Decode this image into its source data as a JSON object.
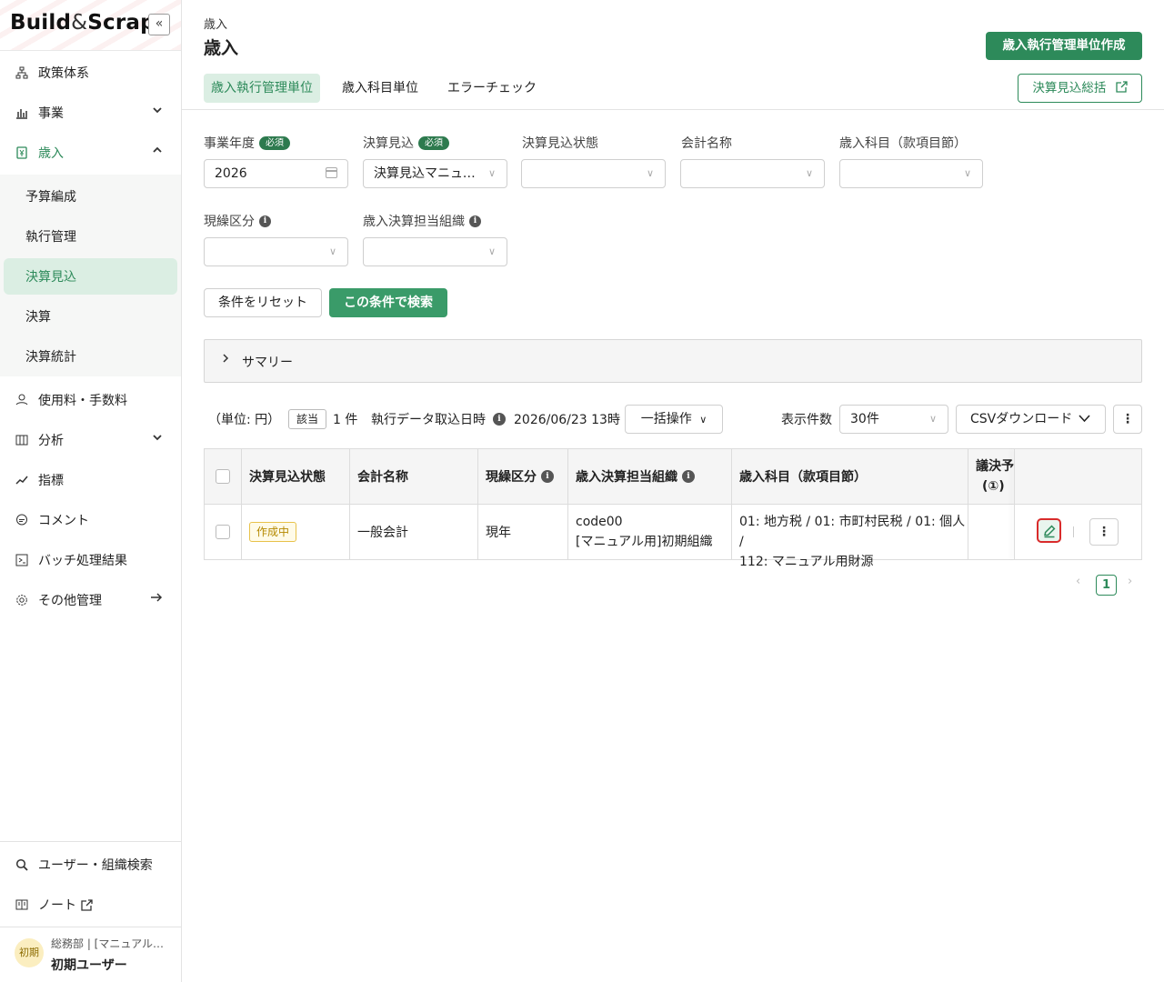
{
  "brand": {
    "name_a": "Build",
    "amp": "&",
    "name_b": "Scrap",
    "collapse_icon": "«"
  },
  "sidebar": {
    "items": [
      {
        "label": "政策体系",
        "icon": "hierarchy-icon"
      },
      {
        "label": "事業",
        "icon": "bar-chart-icon",
        "arrow": "chevron-down"
      },
      {
        "label": "歳入",
        "icon": "revenue-icon",
        "arrow": "chevron-up",
        "active": true
      },
      {
        "label": "使用料・手数料",
        "icon": "fee-icon"
      },
      {
        "label": "分析",
        "icon": "analysis-icon",
        "arrow": "chevron-down"
      },
      {
        "label": "指標",
        "icon": "trend-icon"
      },
      {
        "label": "コメント",
        "icon": "comment-icon"
      },
      {
        "label": "バッチ処理結果",
        "icon": "batch-icon"
      },
      {
        "label": "その他管理",
        "icon": "gear-icon",
        "arrow": "arrow-right"
      }
    ],
    "sub_items": [
      "予算編成",
      "執行管理",
      "決算見込",
      "決算",
      "決算統計"
    ],
    "bottom": [
      {
        "label": "ユーザー・組織検索",
        "icon": "search-icon"
      },
      {
        "label": "ノート",
        "icon": "book-icon"
      }
    ],
    "user": {
      "avatar": "初期",
      "org": "総務部 | [マニュアル用]初期組織",
      "name": "初期ユーザー"
    }
  },
  "header": {
    "breadcrumb": "歳入",
    "title": "歳入",
    "create_button": "歳入執行管理単位作成",
    "summary_button": "決算見込総括",
    "tabs": [
      "歳入執行管理単位",
      "歳入科目単位",
      "エラーチェック"
    ]
  },
  "filters": {
    "required_badge": "必須",
    "fiscal_year": {
      "label": "事業年度",
      "value": "2026"
    },
    "estimate": {
      "label": "決算見込",
      "value": "決算見込マニュアル用"
    },
    "estimate_status": {
      "label": "決算見込状態",
      "value": ""
    },
    "account_name": {
      "label": "会計名称",
      "value": ""
    },
    "revenue_item": {
      "label": "歳入科目（款項目節）",
      "value": ""
    },
    "current_carry": {
      "label": "現繰区分",
      "value": ""
    },
    "org": {
      "label": "歳入決算担当組織",
      "value": ""
    },
    "reset_button": "条件をリセット",
    "search_button": "この条件で検索"
  },
  "summary": {
    "label": "サマリー"
  },
  "toolbar": {
    "unit": "（単位: 円）",
    "match_badge": "該当",
    "count": "1 件",
    "import_label": "執行データ取込日時",
    "import_time": "2026/06/23 13時",
    "bulk_button": "一括操作",
    "display_count_label": "表示件数",
    "display_count_value": "30件",
    "csv_button": "CSVダウンロード"
  },
  "table": {
    "headers": [
      "決算見込状態",
      "会計名称",
      "現繰区分",
      "歳入決算担当組織",
      "歳入科目（款項目節）",
      "議決予",
      "(①)"
    ],
    "rows": [
      {
        "status": "作成中",
        "account": "一般会計",
        "carry": "現年",
        "org_line1": "code00",
        "org_line2": "[マニュアル用]初期組織",
        "item_line1": "01: 地方税 / 01: 市町村民税 / 01: 個人 /",
        "item_line2": "112: マニュアル用財源"
      }
    ]
  },
  "pagination": {
    "current": "1",
    "prev": "‹",
    "next": "›"
  },
  "colors": {
    "accent": "#2d8a5a",
    "accent_light": "#dbeee3",
    "status_border": "#e8c24a",
    "highlight": "#d92b2b"
  }
}
